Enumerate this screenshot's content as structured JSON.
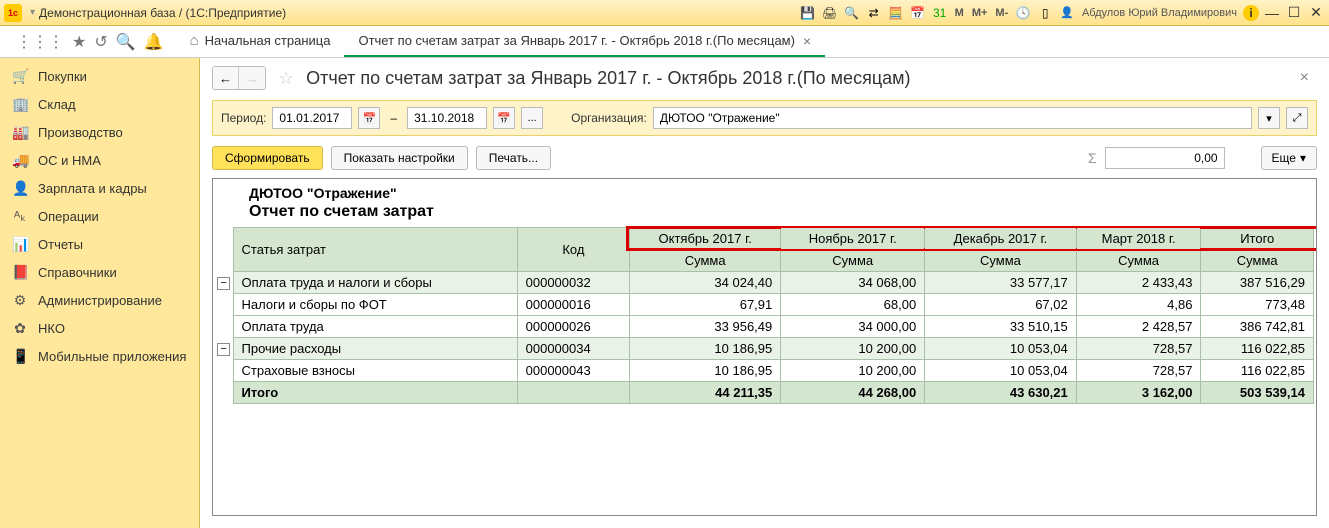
{
  "titlebar": {
    "text": "Демонстрационная база / (1С:Предприятие)",
    "user": "Абдулов Юрий Владимирович"
  },
  "tabs": {
    "home": "Начальная страница",
    "report": "Отчет по счетам затрат за Январь 2017 г. - Октябрь 2018 г.(По месяцам)"
  },
  "sidebar": [
    {
      "icon": "🛒",
      "label": "Покупки"
    },
    {
      "icon": "🏢",
      "label": "Склад"
    },
    {
      "icon": "🏭",
      "label": "Производство"
    },
    {
      "icon": "🚚",
      "label": "ОС и НМА"
    },
    {
      "icon": "👤",
      "label": "Зарплата и кадры"
    },
    {
      "icon": "ᴬₖ",
      "label": "Операции"
    },
    {
      "icon": "📊",
      "label": "Отчеты"
    },
    {
      "icon": "📕",
      "label": "Справочники"
    },
    {
      "icon": "⚙",
      "label": "Администрирование"
    },
    {
      "icon": "✿",
      "label": "НКО"
    },
    {
      "icon": "📱",
      "label": "Мобильные приложения"
    }
  ],
  "page": {
    "title": "Отчет по счетам затрат за Январь 2017 г. - Октябрь 2018 г.(По месяцам)",
    "period_label": "Период:",
    "date_from": "01.01.2017",
    "date_to": "31.10.2018",
    "org_label": "Организация:",
    "org_value": "ДЮТОО \"Отражение\"",
    "btn_form": "Сформировать",
    "btn_settings": "Показать настройки",
    "btn_print": "Печать...",
    "sum": "0,00",
    "btn_more": "Еще"
  },
  "report": {
    "org": "ДЮТОО \"Отражение\"",
    "title": "Отчет по счетам затрат",
    "col_article": "Статья затрат",
    "col_code": "Код",
    "col_sum": "Сумма",
    "col_total": "Итого",
    "periods": [
      "Октябрь 2017 г.",
      "Ноябрь 2017 г.",
      "Декабрь 2017 г.",
      "Март 2018 г."
    ],
    "rows": [
      {
        "type": "group",
        "label": "Оплата труда и налоги и сборы",
        "code": "000000032",
        "v": [
          "34 024,40",
          "34 068,00",
          "33 577,17",
          "2 433,43",
          "387 516,29"
        ]
      },
      {
        "type": "sub",
        "label": "Налоги и сборы по ФОТ",
        "code": "000000016",
        "v": [
          "67,91",
          "68,00",
          "67,02",
          "4,86",
          "773,48"
        ]
      },
      {
        "type": "sub",
        "label": "Оплата труда",
        "code": "000000026",
        "v": [
          "33 956,49",
          "34 000,00",
          "33 510,15",
          "2 428,57",
          "386 742,81"
        ]
      },
      {
        "type": "group",
        "label": "Прочие расходы",
        "code": "000000034",
        "v": [
          "10 186,95",
          "10 200,00",
          "10 053,04",
          "728,57",
          "116 022,85"
        ]
      },
      {
        "type": "sub",
        "label": "Страховые взносы",
        "code": "000000043",
        "v": [
          "10 186,95",
          "10 200,00",
          "10 053,04",
          "728,57",
          "116 022,85"
        ]
      },
      {
        "type": "bold",
        "label": "Итого",
        "code": "",
        "v": [
          "44 211,35",
          "44 268,00",
          "43 630,21",
          "3 162,00",
          "503 539,14"
        ]
      }
    ]
  }
}
